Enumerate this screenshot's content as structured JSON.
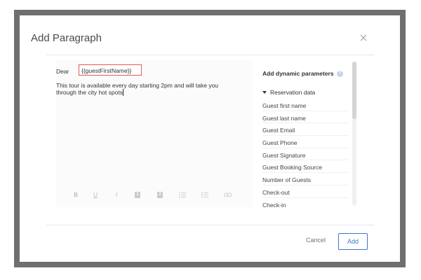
{
  "dialog": {
    "title": "Add Paragraph"
  },
  "editor": {
    "greeting": "Dear",
    "parameter_chip": "{{guestFirstName}}",
    "paragraph_line1": "This tour is available every day starting 2pm and will take you",
    "paragraph_line2": "through the city hot spots",
    "toolbar": {
      "bold": "B",
      "underline": "U",
      "italic": "I",
      "heading1": "1",
      "heading2": "2"
    }
  },
  "parameters_panel": {
    "title": "Add dynamic parameters",
    "section": "Reservation data",
    "items": [
      "Guest first name",
      "Guest last name",
      "Guest Email",
      "Guest Phone",
      "Guest Signature",
      "Guest Booking Source",
      "Number of Guests",
      "Check-out",
      "Check-in"
    ]
  },
  "footer": {
    "cancel_label": "Cancel",
    "add_label": "Add"
  },
  "colors": {
    "accent": "#3f74c9",
    "chip_border": "#e45a5a",
    "backdrop": "#6f6f6f"
  }
}
